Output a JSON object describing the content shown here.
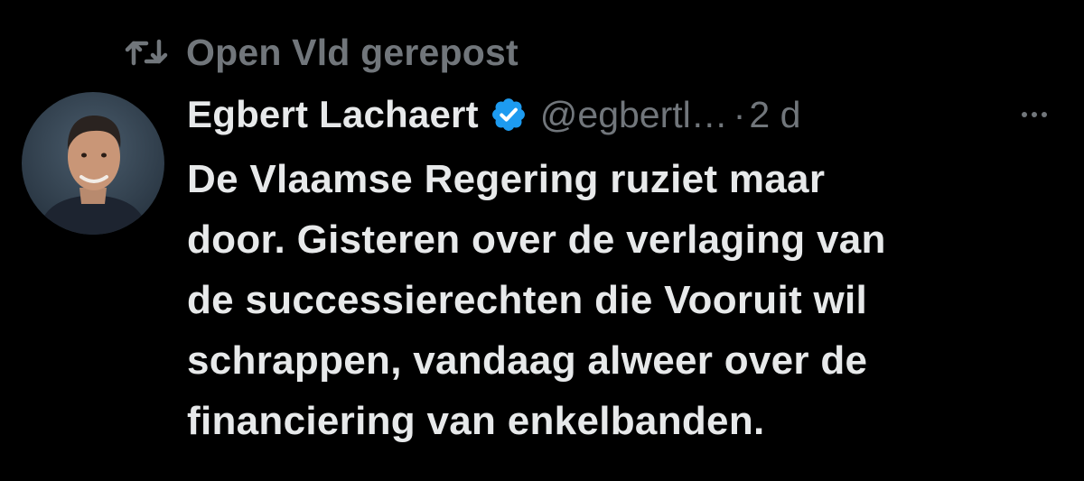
{
  "repost": {
    "icon": "repost-icon",
    "label": "Open Vld gerepost"
  },
  "post": {
    "avatar_icon": "avatar",
    "author_name": "Egbert Lachaert",
    "verified_icon": "verified-badge-icon",
    "handle": "@egbertl…",
    "separator": "·",
    "time": "2 d",
    "more_icon": "more-icon",
    "text_lines": [
      "De Vlaamse Regering ruziet maar",
      "door. Gisteren over de verlaging van",
      "de successierechten die Vooruit wil",
      "schrappen, vandaag alweer over de",
      "financiering van enkelbanden."
    ]
  },
  "colors": {
    "background": "#000000",
    "primary_text": "#e7e9ea",
    "secondary_text": "#71767b",
    "verified_blue": "#1d9bf0"
  }
}
